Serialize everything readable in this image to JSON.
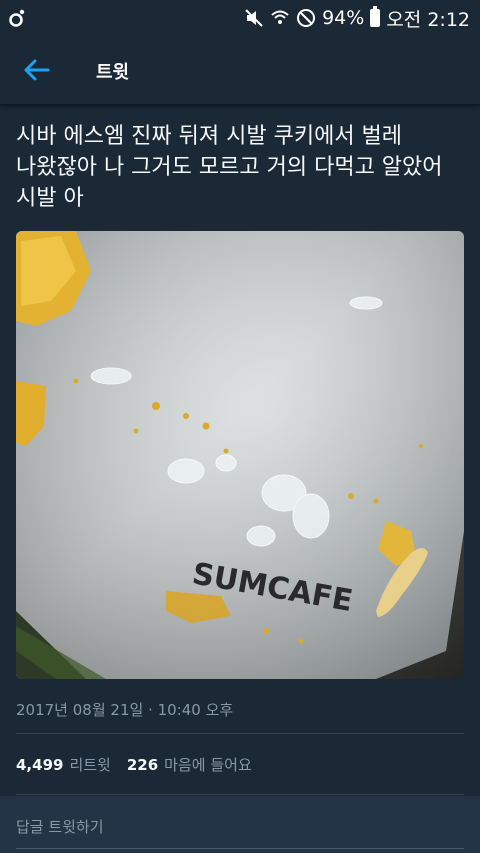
{
  "status_bar": {
    "battery_percent": "94%",
    "time": "오전 2:12",
    "icons": [
      "app-logo-icon",
      "mute-vibrate-icon",
      "wifi-icon",
      "do-not-disturb-icon",
      "battery-icon"
    ]
  },
  "header": {
    "title": "트윗",
    "back_icon": "arrow-left-icon"
  },
  "tweet": {
    "text": "시바 에스엠 진짜 뒤져 시발 쿠키에서 벌레\n나왔잖아 나 그거도 모르고 거의 다먹고 알았어\n시발 아",
    "photo_text": "SUMCAFE",
    "timestamp": "2017년 08월 21일 · 10:40 오후",
    "retweet_count": "4,499",
    "retweet_label": "리트윗",
    "like_count": "226",
    "like_label": "마음에 들어요"
  },
  "reply": {
    "placeholder": "답글 트윗하기"
  },
  "colors": {
    "background": "#1b2836",
    "accent": "#1da1f2",
    "muted": "#8899a6"
  }
}
